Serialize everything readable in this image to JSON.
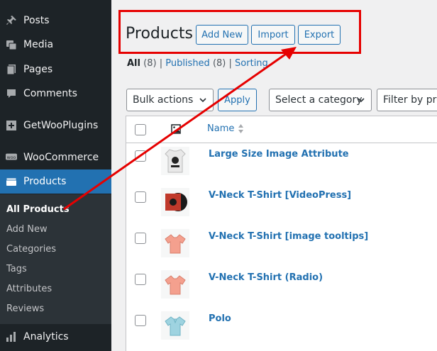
{
  "sidebar": {
    "items": [
      {
        "label": "Posts",
        "icon": "pin-icon"
      },
      {
        "label": "Media",
        "icon": "media-icon"
      },
      {
        "label": "Pages",
        "icon": "pages-icon"
      },
      {
        "label": "Comments",
        "icon": "comment-icon"
      },
      {
        "label": "GetWooPlugins",
        "icon": "plugins-icon"
      },
      {
        "label": "WooCommerce",
        "icon": "woo-icon"
      },
      {
        "label": "Products",
        "icon": "products-icon"
      },
      {
        "label": "Analytics",
        "icon": "analytics-icon"
      }
    ],
    "submenu": [
      "All Products",
      "Add New",
      "Categories",
      "Tags",
      "Attributes",
      "Reviews"
    ]
  },
  "header": {
    "title": "Products",
    "buttons": [
      "Add New",
      "Import",
      "Export"
    ]
  },
  "filters": {
    "all_label": "All",
    "all_count": "(8)",
    "published_label": "Published",
    "published_count": "(8)",
    "sorting_label": "Sorting",
    "sep": "|"
  },
  "toolbar": {
    "bulk_actions": "Bulk actions",
    "apply": "Apply",
    "category": "Select a category",
    "filter_by": "Filter by pro"
  },
  "table": {
    "col_name": "Name",
    "rows": [
      {
        "name": "Large Size Image Attribute",
        "thumb": "shirt-bw"
      },
      {
        "name": "V-Neck T-Shirt [VideoPress]",
        "thumb": "album"
      },
      {
        "name": "V-Neck T-Shirt [image tooltips]",
        "thumb": "vneck-pink"
      },
      {
        "name": "V-Neck T-Shirt (Radio)",
        "thumb": "vneck-pink"
      },
      {
        "name": "Polo",
        "thumb": "polo-blue"
      }
    ]
  },
  "colors": {
    "accent": "#2271b1",
    "sidebar": "#1d2327",
    "annotation": "#e60000"
  }
}
